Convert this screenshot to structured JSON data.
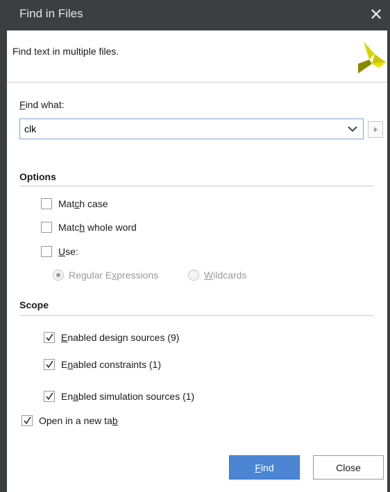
{
  "dialog": {
    "title": "Find in Files",
    "close_glyph": "✕",
    "description": "Find text in multiple files."
  },
  "find": {
    "label_key": "F",
    "label_rest": "ind what:",
    "value": "clk"
  },
  "options": {
    "heading": "Options",
    "match_case": {
      "pre": "Mat",
      "key": "c",
      "post": "h case",
      "checked": false
    },
    "match_whole_word": {
      "pre": "Matc",
      "key": "h",
      "post": " whole word",
      "checked": false
    },
    "use": {
      "pre": "",
      "key": "U",
      "post": "se:",
      "checked": false
    },
    "regex": {
      "pre": "Regular E",
      "key": "x",
      "post": "pressions",
      "selected": true
    },
    "wildcards": {
      "pre": "",
      "key": "W",
      "post": "ildcards",
      "selected": false
    }
  },
  "scope": {
    "heading": "Scope",
    "design": {
      "pre": "",
      "key": "E",
      "post": "nabled design sources (9)",
      "checked": true
    },
    "constraints": {
      "pre": "E",
      "key": "n",
      "post": "abled constraints (1)",
      "checked": true
    },
    "simulation": {
      "pre": "En",
      "key": "a",
      "post": "bled simulation sources (1)",
      "checked": true
    }
  },
  "open_new_tab": {
    "pre": "Open in a new ta",
    "key": "b",
    "post": "",
    "checked": true
  },
  "buttons": {
    "find": {
      "key": "F",
      "rest": "ind"
    },
    "close": "Close"
  },
  "colors": {
    "titlebar": "#3c3f41",
    "accent": "#4a86d4",
    "logo_yellow": "#d8d600",
    "logo_olive": "#8a8a00"
  },
  "icons": [
    "close-icon",
    "xilinx-logo",
    "chevron-down-icon",
    "play-arrow-icon",
    "checkmark-icon"
  ]
}
